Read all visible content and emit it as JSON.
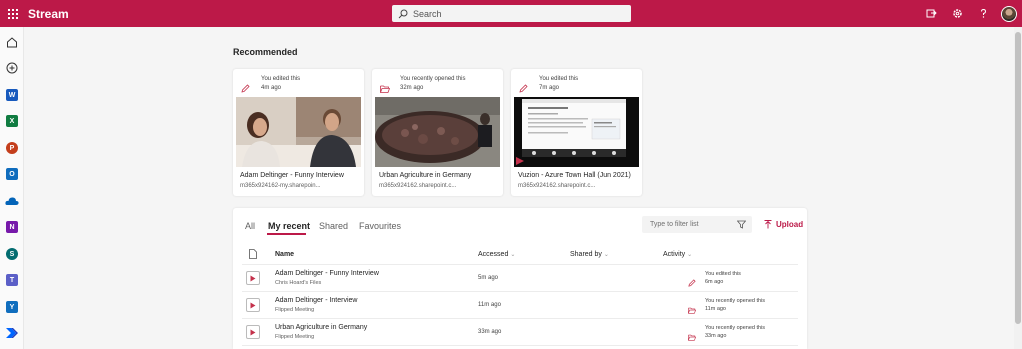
{
  "app": {
    "title": "Stream"
  },
  "search": {
    "placeholder": "Search"
  },
  "main": {
    "section_title": "Recommended"
  },
  "recommended": [
    {
      "activity": "You edited this",
      "time": "4m ago",
      "title": "Adam Deltinger - Funny Interview",
      "url": "m365x924162-my.sharepoin...",
      "icon": "pencil-icon"
    },
    {
      "activity": "You recently opened this",
      "time": "32m ago",
      "title": "Urban Agriculture in Germany",
      "url": "m365x924162.sharepoint.c...",
      "icon": "folder-open-icon"
    },
    {
      "activity": "You edited this",
      "time": "7m ago",
      "title": "Vuzion - Azure Town Hall (Jun 2021)",
      "url": "m365x924162.sharepoint.c...",
      "icon": "pencil-icon"
    }
  ],
  "list": {
    "tabs": [
      "All",
      "My recent",
      "Shared",
      "Favourites"
    ],
    "filter_placeholder": "Type to filter list",
    "upload_label": "Upload",
    "columns": {
      "name": "Name",
      "accessed": "Accessed",
      "shared_by": "Shared by",
      "activity": "Activity"
    },
    "rows": [
      {
        "title": "Adam Deltinger - Funny Interview",
        "location": "Chris Hoard's Files",
        "accessed": "5m ago",
        "activity": "You edited this",
        "activity_time": "6m ago",
        "icon": "pencil-icon"
      },
      {
        "title": "Adam Deltinger - Interview",
        "location": "Flipped Meeting",
        "accessed": "11m ago",
        "activity": "You recently opened this",
        "activity_time": "11m ago",
        "icon": "folder-open-icon"
      },
      {
        "title": "Urban Agriculture in Germany",
        "location": "Flipped Meeting",
        "accessed": "33m ago",
        "activity": "You recently opened this",
        "activity_time": "33m ago",
        "icon": "folder-open-icon"
      }
    ]
  },
  "rail": [
    "home-icon",
    "create-icon",
    "word-icon",
    "excel-icon",
    "powerpoint-icon",
    "outlook-icon",
    "onedrive-icon",
    "onenote-icon",
    "sharepoint-icon",
    "teams-icon",
    "yammer-icon",
    "power-automate-icon"
  ],
  "colors": {
    "brand": "#bc1948",
    "accent": "#c4314b"
  }
}
